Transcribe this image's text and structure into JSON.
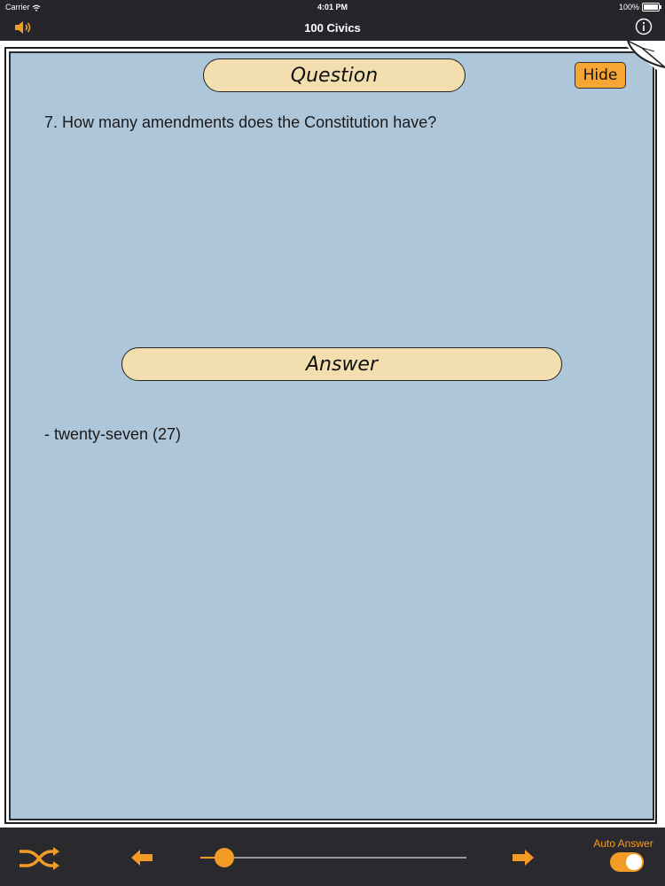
{
  "status_bar": {
    "carrier": "Carrier",
    "time": "4:01 PM",
    "battery": "100%"
  },
  "nav": {
    "title": "100 Civics",
    "left_icon": "speaker-icon",
    "right_icon": "info-icon"
  },
  "card": {
    "question_header": "Question",
    "hide_label": "Hide",
    "question": "7. How many amendments does the Constitution have?",
    "answer_header": "Answer",
    "answer": "- twenty-seven (27)"
  },
  "toolbar": {
    "shuffle_icon": "shuffle-icon",
    "prev_icon": "arrow-left-icon",
    "next_icon": "arrow-right-icon",
    "progress": 0.09,
    "auto_answer_label": "Auto Answer",
    "auto_answer_on": true
  },
  "colors": {
    "accent": "#f39c25",
    "card_bg": "#aec6da",
    "pill_bg": "#f3deb0",
    "bar_bg": "#26262a"
  }
}
